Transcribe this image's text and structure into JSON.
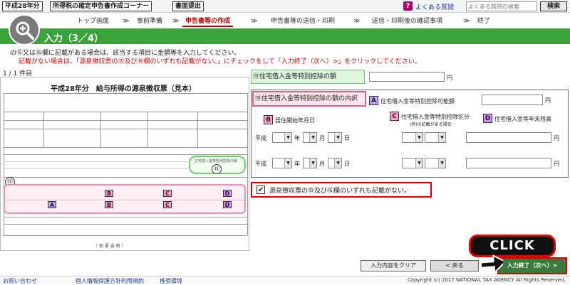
{
  "header": {
    "year_label": "平成28年分",
    "app_title": "所得税の確定申告書作成コーナー",
    "mode_label": "書面提出",
    "faq_link": "よくある質問",
    "faq_search_placeholder": "よくある質問の検索",
    "search_button": "検索"
  },
  "steps": [
    {
      "label": "トップ画面",
      "active": false
    },
    {
      "label": "事前準備",
      "active": false
    },
    {
      "label": "申告書等の作成",
      "active": true
    },
    {
      "label": "申告書等の送信・印刷",
      "active": false
    },
    {
      "label": "送信・印刷後の確認事項",
      "active": false
    },
    {
      "label": "終了",
      "active": false
    }
  ],
  "step_separator": "≫",
  "title_bar": "入力（3／4）",
  "instructions": {
    "line1": "の⑮又は⑯欄に記載がある場合は、該当する項目に金額等を入力してください。",
    "line2": "記載がない場合は、「源泉徴収票の⑮及び⑯欄のいずれも記載がない。」にチェックをして「入力終了（次へ）>」をクリックしてください。"
  },
  "pager": "1 / 1 件目",
  "document": {
    "title": "平成28年分　給与所得の源泉徴収票（見本）",
    "mark15_label": "住宅借入金等特別控除の額",
    "num15": "⑮",
    "num16": "⑯",
    "mini_footer": "（ 摘 要 省 略 ）"
  },
  "form": {
    "f15_label": "⑮住宅借入金等特別控除の額",
    "f16_label": "⑯住宅借入金等特別控除の額の内訳",
    "yen": "円",
    "a_label": "住宅借入金等特別控除可能額",
    "b_label": "居住開始年月日",
    "c_label": "住宅借入金等特別控除区分",
    "c_sub": "(特)の記載がある場合",
    "d_label": "住宅借入金等年末残高",
    "era": "平成",
    "year": "年",
    "month": "月",
    "day": "日",
    "letters": {
      "a": "A",
      "b": "B",
      "c": "C",
      "d": "D"
    }
  },
  "checkbox": {
    "checked": true,
    "label": "源泉徴収票の⑮及び⑯欄のいずれも記載がない。"
  },
  "buttons": {
    "clear": "入力内容をクリア",
    "back": "< 戻る",
    "finish": "入力終了（次へ）>"
  },
  "callout": "CLICK",
  "footer": {
    "links": [
      "お問い合わせ",
      "個人情報保護方針",
      "利用規約",
      "推奨環境"
    ],
    "copyright": "Copyright (c) 2017 NATIONAL TAX AGENCY All Rights Reserved."
  },
  "colors": {
    "title_green": "#3aa43a",
    "alert_red": "#e00000",
    "a_purple": "#c4a0ff",
    "b_pink": "#ff9ecf",
    "d_violet": "#d48cff"
  }
}
